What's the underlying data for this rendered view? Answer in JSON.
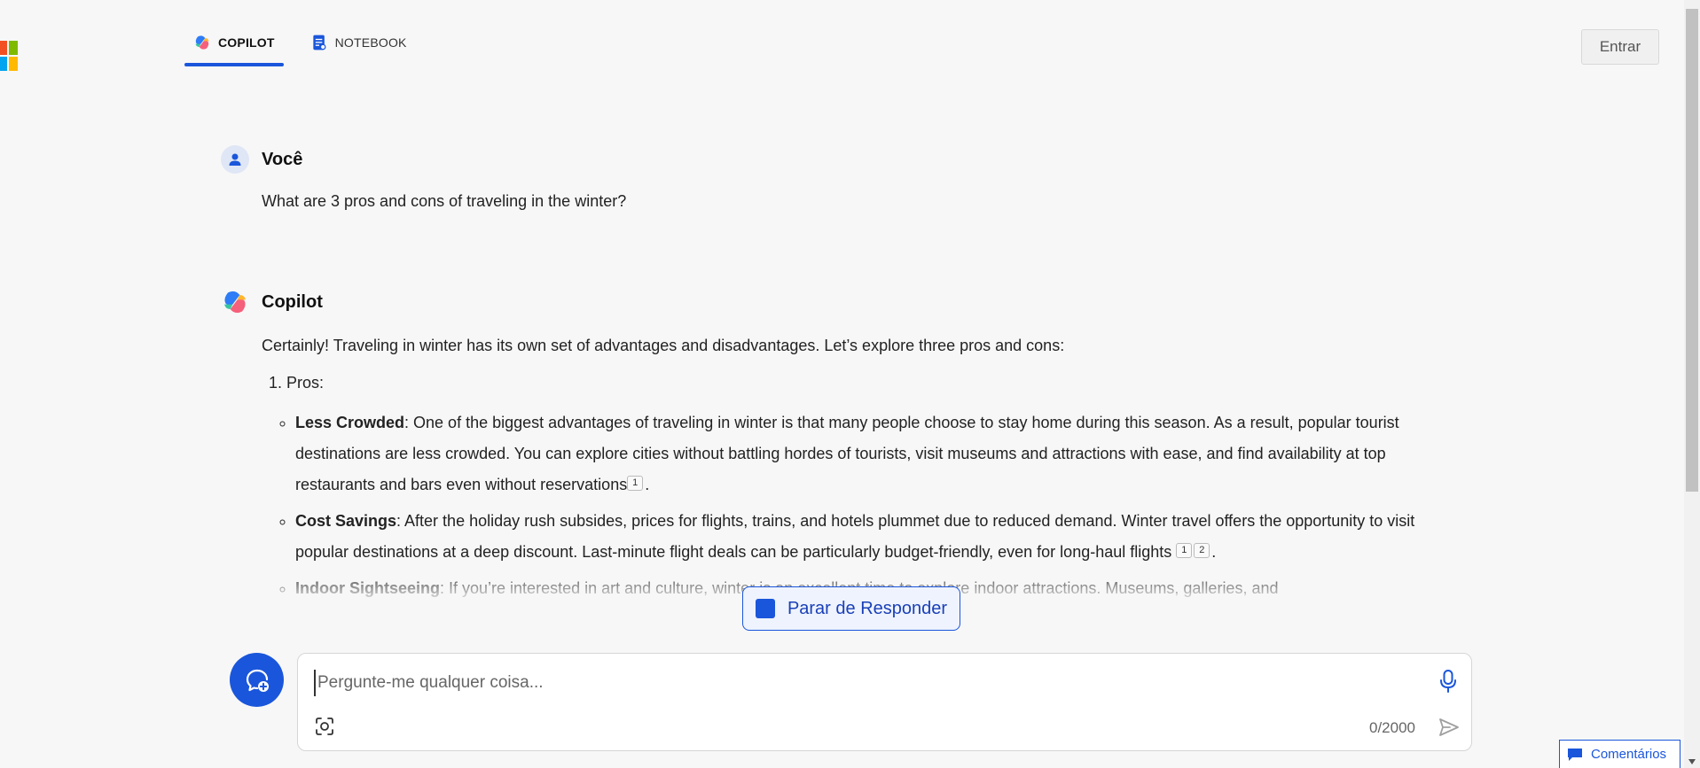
{
  "tabs": [
    {
      "label": "COPILOT",
      "active": true
    },
    {
      "label": "NOTEBOOK",
      "active": false
    }
  ],
  "header": {
    "signin_label": "Entrar"
  },
  "user_message": {
    "name": "Você",
    "text": "What are 3 pros and cons of traveling in the winter?"
  },
  "assistant_message": {
    "name": "Copilot",
    "intro": "Certainly! Traveling in winter has its own set of advantages and disadvantages. Let’s explore three pros and cons:",
    "section_number": "1.",
    "section_label": "Pros:",
    "items": [
      {
        "title": "Less Crowded",
        "text": ": One of the biggest advantages of traveling in winter is that many people choose to stay home during this season. As a result, popular tourist destinations are less crowded. You can explore cities without battling hordes of tourists, visit museums and attractions with ease, and find availability at top restaurants and bars even without reservations",
        "citations": [
          "1"
        ]
      },
      {
        "title": "Cost Savings",
        "text": ": After the holiday rush subsides, prices for flights, trains, and hotels plummet due to reduced demand. Winter travel offers the opportunity to visit popular destinations at a deep discount. Last-minute flight deals can be particularly budget-friendly, even for long-haul flights",
        "citations": [
          "1",
          "2"
        ]
      },
      {
        "title": "Indoor Sightseeing",
        "text": ": If you’re interested in art and culture, winter is an excellent time to explore indoor attractions. Museums, galleries, and",
        "citations": []
      }
    ]
  },
  "stop_button": {
    "label": "Parar de Responder"
  },
  "composer": {
    "placeholder": "Pergunte-me qualquer coisa...",
    "value": "",
    "counter": "0/2000"
  },
  "feedback": {
    "label": "Comentários"
  },
  "colors": {
    "accent": "#1a56db",
    "background": "#f7f7f7"
  },
  "icons": [
    "microsoft-logo-icon",
    "copilot-logo-icon",
    "notebook-icon",
    "user-icon",
    "new-chat-icon",
    "microphone-icon",
    "visual-search-icon",
    "send-icon",
    "feedback-icon"
  ]
}
